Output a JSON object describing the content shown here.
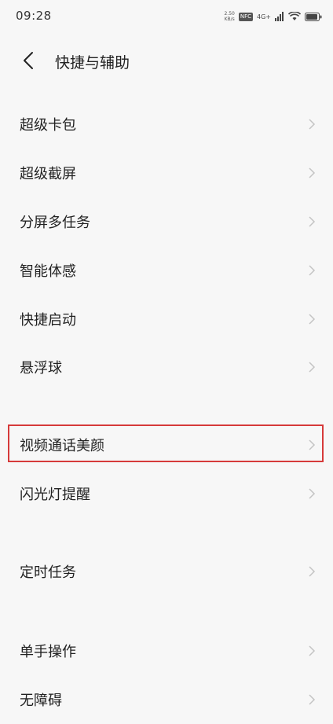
{
  "status_bar": {
    "time": "09:28",
    "speed_value": "2.50",
    "speed_unit": "KB/s",
    "nfc": "NFC",
    "network": "4G+"
  },
  "header": {
    "title": "快捷与辅助"
  },
  "menu": {
    "items": [
      {
        "label": "超级卡包"
      },
      {
        "label": "超级截屏"
      },
      {
        "label": "分屏多任务"
      },
      {
        "label": "智能体感"
      },
      {
        "label": "快捷启动"
      },
      {
        "label": "悬浮球"
      },
      {
        "label": "视频通话美颜"
      },
      {
        "label": "闪光灯提醒"
      },
      {
        "label": "定时任务"
      },
      {
        "label": "单手操作"
      },
      {
        "label": "无障碍"
      }
    ]
  },
  "colors": {
    "background": "#f7f7f7",
    "highlight": "#d63a3a",
    "chevron": "#c4c4c4"
  }
}
